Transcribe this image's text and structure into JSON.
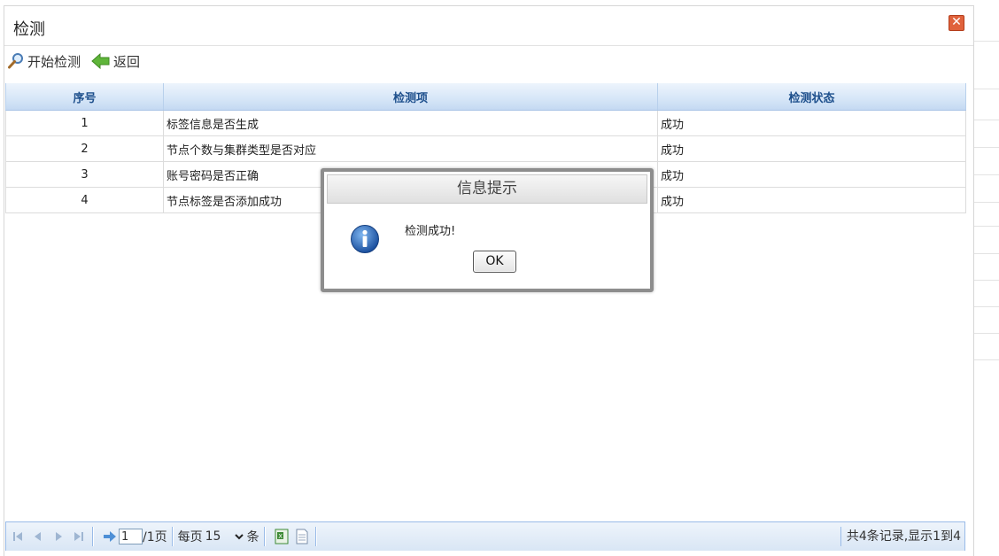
{
  "window": {
    "title": "检测",
    "close_icon": "close-icon"
  },
  "toolbar": {
    "start_label": "开始检测",
    "back_label": "返回"
  },
  "table": {
    "headers": [
      "序号",
      "检测项",
      "检测状态"
    ],
    "rows": [
      {
        "no": "1",
        "item": "标签信息是否生成",
        "status": "成功"
      },
      {
        "no": "2",
        "item": "节点个数与集群类型是否对应",
        "status": "成功"
      },
      {
        "no": "3",
        "item": "账号密码是否正确",
        "status": "成功"
      },
      {
        "no": "4",
        "item": "节点标签是否添加成功",
        "status": "成功"
      }
    ]
  },
  "dialog": {
    "title": "信息提示",
    "message": "检测成功!",
    "ok_label": "OK",
    "icon": "info-icon"
  },
  "pager": {
    "page_value": "1",
    "total_pages": "/1页",
    "per_page_label": "每页",
    "page_size": "15",
    "unit_label": "条",
    "summary": "共4条记录,显示1到4"
  },
  "colors": {
    "header_text": "#1d4f8c",
    "close_bg": "#e0623c",
    "pager_border": "#99bbe8"
  }
}
